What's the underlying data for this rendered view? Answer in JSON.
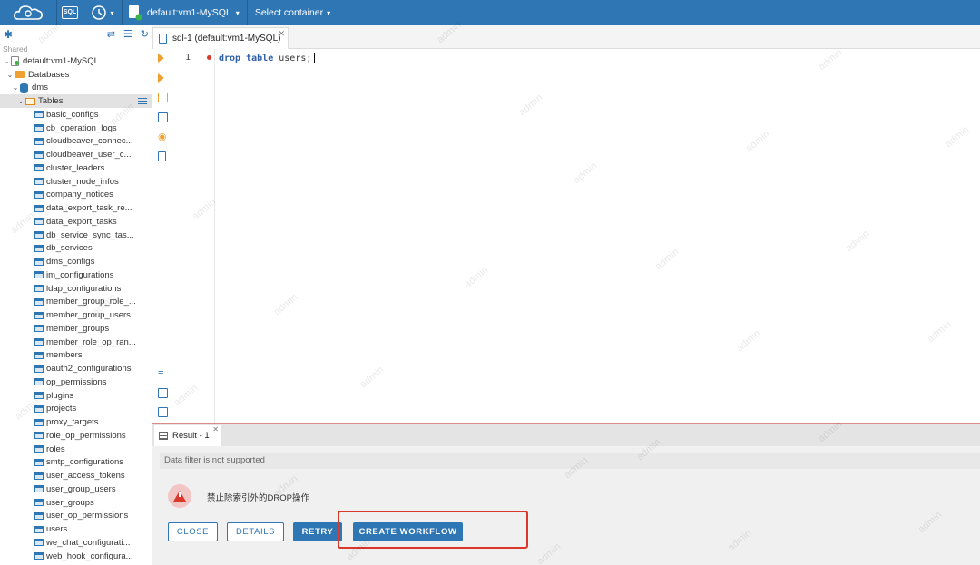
{
  "topbar": {
    "sql_label": "SQL",
    "connection": "default:vm1-MySQL",
    "container": "Select container"
  },
  "navigator": {
    "section": "Shared",
    "connection": "default:vm1-MySQL",
    "databases_label": "Databases",
    "database": "dms",
    "tables_label": "Tables",
    "tables": [
      "basic_configs",
      "cb_operation_logs",
      "cloudbeaver_connec...",
      "cloudbeaver_user_c...",
      "cluster_leaders",
      "cluster_node_infos",
      "company_notices",
      "data_export_task_re...",
      "data_export_tasks",
      "db_service_sync_tas...",
      "db_services",
      "dms_configs",
      "im_configurations",
      "ldap_configurations",
      "member_group_role_...",
      "member_group_users",
      "member_groups",
      "member_role_op_ran...",
      "members",
      "oauth2_configurations",
      "op_permissions",
      "plugins",
      "projects",
      "proxy_targets",
      "role_op_permissions",
      "roles",
      "smtp_configurations",
      "user_access_tokens",
      "user_group_users",
      "user_groups",
      "user_op_permissions",
      "users",
      "we_chat_configurati...",
      "web_hook_configura..."
    ]
  },
  "editor": {
    "tab_label": "sql-1 (default:vm1-MySQL)",
    "line_number": "1",
    "code_kw1": "drop",
    "code_kw2": "table",
    "code_rest": "users;"
  },
  "result": {
    "tab_label": "Result - 1",
    "filter_text": "Data filter is not supported",
    "error_message": "禁止除索引外的DROP操作",
    "buttons": {
      "close": "CLOSE",
      "details": "DETAILS",
      "retry": "RETRY",
      "create_workflow": "CREATE WORKFLOW"
    }
  },
  "watermark": "admin",
  "colors": {
    "primary": "#2f76b4",
    "error": "#d9382b",
    "folder": "#f0a030"
  }
}
